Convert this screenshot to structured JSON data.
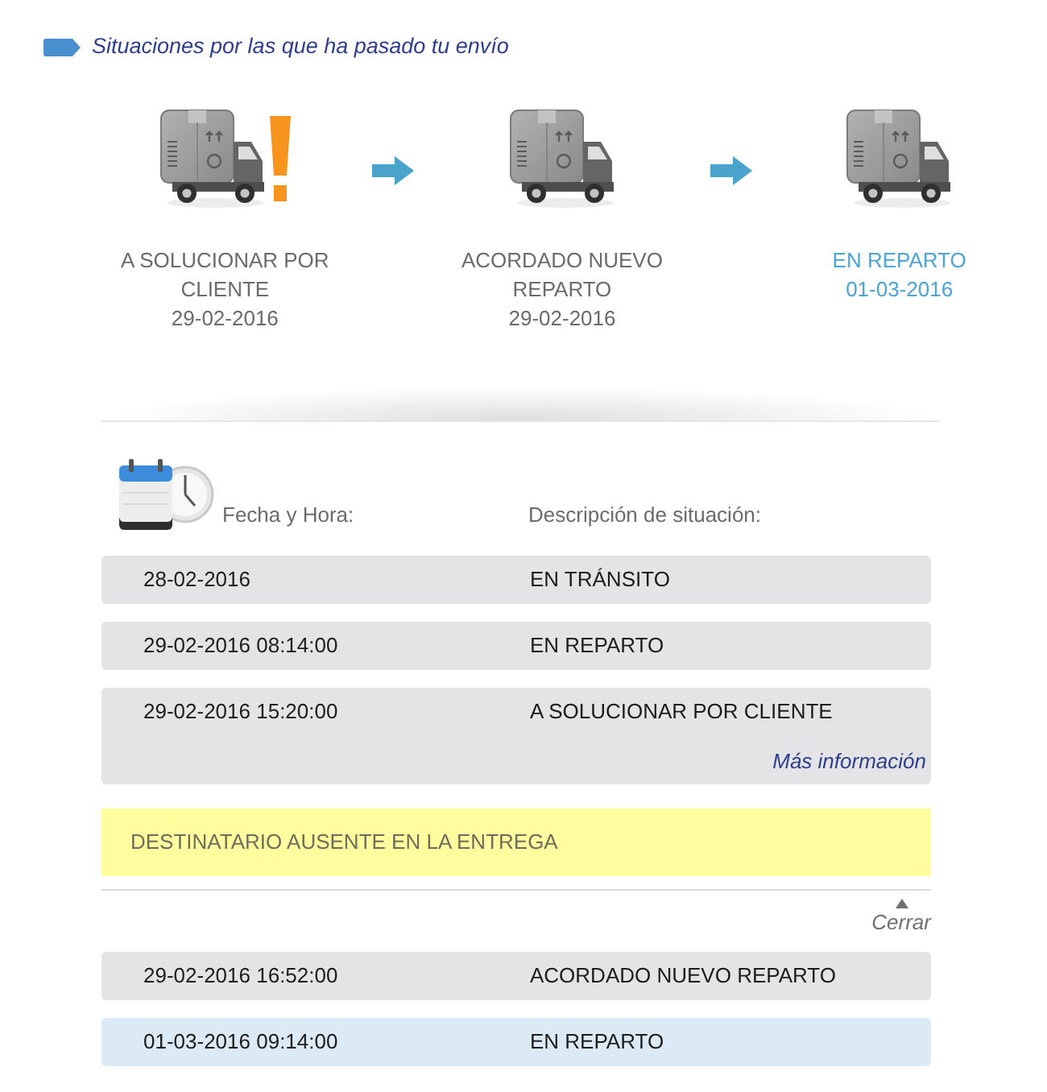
{
  "header": {
    "title": "Situaciones por las que ha pasado tu envío"
  },
  "steps": [
    {
      "status": "A SOLUCIONAR POR CLIENTE",
      "date": "29-02-2016",
      "alert": true,
      "selected": false
    },
    {
      "status": "ACORDADO NUEVO REPARTO",
      "date": "29-02-2016",
      "alert": false,
      "selected": false
    },
    {
      "status": "EN REPARTO",
      "date": "01-03-2016",
      "alert": false,
      "selected": true
    }
  ],
  "history": {
    "columns": [
      "Fecha y Hora:",
      "Descripción de situación:"
    ],
    "rows": [
      {
        "datetime": "28-02-2016",
        "description": "EN TRÁNSITO",
        "selected": false
      },
      {
        "datetime": "29-02-2016 08:14:00",
        "description": "EN REPARTO",
        "selected": false
      },
      {
        "datetime": "29-02-2016 15:20:00",
        "description": "A SOLUCIONAR POR CLIENTE",
        "selected": false,
        "more_link": "Más información",
        "expanded": true,
        "note": "DESTINATARIO AUSENTE EN LA ENTREGA",
        "close_label": "Cerrar"
      },
      {
        "datetime": "29-02-2016 16:52:00",
        "description": "ACORDADO NUEVO REPARTO",
        "selected": false
      },
      {
        "datetime": "01-03-2016 09:14:00",
        "description": "EN REPARTO",
        "selected": true
      }
    ]
  }
}
